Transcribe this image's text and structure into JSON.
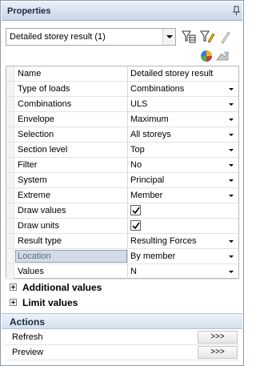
{
  "panel": {
    "title": "Properties"
  },
  "selector": {
    "value": "Detailed storey result (1)"
  },
  "toolbar": {
    "icons": [
      "filter-table-icon",
      "filter-edit-icon",
      "edit-pencil-icon",
      "color-palette-icon",
      "render-icon"
    ]
  },
  "properties": [
    {
      "name": "Name",
      "value": "Detailed storey result",
      "kind": "text"
    },
    {
      "name": "Type of loads",
      "value": "Combinations",
      "kind": "dropdown"
    },
    {
      "name": "Combinations",
      "value": "ULS",
      "kind": "dropdown"
    },
    {
      "name": "Envelope",
      "value": "Maximum",
      "kind": "dropdown"
    },
    {
      "name": "Selection",
      "value": "All storeys",
      "kind": "dropdown"
    },
    {
      "name": "Section level",
      "value": "Top",
      "kind": "dropdown"
    },
    {
      "name": "Filter",
      "value": "No",
      "kind": "dropdown"
    },
    {
      "name": "System",
      "value": "Principal",
      "kind": "dropdown"
    },
    {
      "name": "Extreme",
      "value": "Member",
      "kind": "dropdown"
    },
    {
      "name": "Draw values",
      "value": "checked",
      "kind": "checkbox"
    },
    {
      "name": "Draw units",
      "value": "checked",
      "kind": "checkbox"
    },
    {
      "name": "Result type",
      "value": "Resulting Forces",
      "kind": "dropdown"
    },
    {
      "name": "Location",
      "value": "By member",
      "kind": "dropdown"
    },
    {
      "name": "Values",
      "value": "N",
      "kind": "dropdown"
    }
  ],
  "sections": [
    {
      "label": "Additional values"
    },
    {
      "label": "Limit values"
    }
  ],
  "actions": {
    "label": "Actions",
    "items": [
      {
        "name": "Refresh",
        "button": ">>>"
      },
      {
        "name": "Preview",
        "button": ">>>"
      }
    ]
  },
  "colors": {
    "title_bar": "#c9d6e6",
    "selected_row": "#d3dbe6",
    "border": "#8a9bb0"
  }
}
